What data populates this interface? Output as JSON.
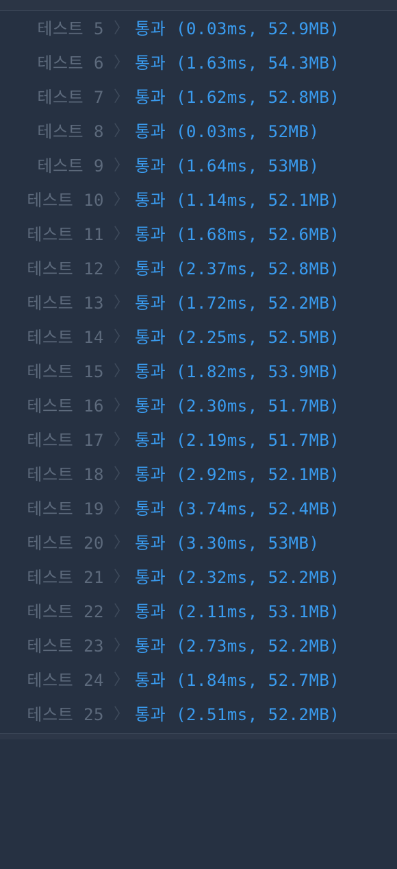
{
  "tests": [
    {
      "label": "테스트 5",
      "separator": "〉",
      "result": "통과 (0.03ms, 52.9MB)"
    },
    {
      "label": "테스트 6",
      "separator": "〉",
      "result": "통과 (1.63ms, 54.3MB)"
    },
    {
      "label": "테스트 7",
      "separator": "〉",
      "result": "통과 (1.62ms, 52.8MB)"
    },
    {
      "label": "테스트 8",
      "separator": "〉",
      "result": "통과 (0.03ms, 52MB)"
    },
    {
      "label": "테스트 9",
      "separator": "〉",
      "result": "통과 (1.64ms, 53MB)"
    },
    {
      "label": "테스트 10",
      "separator": "〉",
      "result": "통과 (1.14ms, 52.1MB)"
    },
    {
      "label": "테스트 11",
      "separator": "〉",
      "result": "통과 (1.68ms, 52.6MB)"
    },
    {
      "label": "테스트 12",
      "separator": "〉",
      "result": "통과 (2.37ms, 52.8MB)"
    },
    {
      "label": "테스트 13",
      "separator": "〉",
      "result": "통과 (1.72ms, 52.2MB)"
    },
    {
      "label": "테스트 14",
      "separator": "〉",
      "result": "통과 (2.25ms, 52.5MB)"
    },
    {
      "label": "테스트 15",
      "separator": "〉",
      "result": "통과 (1.82ms, 53.9MB)"
    },
    {
      "label": "테스트 16",
      "separator": "〉",
      "result": "통과 (2.30ms, 51.7MB)"
    },
    {
      "label": "테스트 17",
      "separator": "〉",
      "result": "통과 (2.19ms, 51.7MB)"
    },
    {
      "label": "테스트 18",
      "separator": "〉",
      "result": "통과 (2.92ms, 52.1MB)"
    },
    {
      "label": "테스트 19",
      "separator": "〉",
      "result": "통과 (3.74ms, 52.4MB)"
    },
    {
      "label": "테스트 20",
      "separator": "〉",
      "result": "통과 (3.30ms, 53MB)"
    },
    {
      "label": "테스트 21",
      "separator": "〉",
      "result": "통과 (2.32ms, 52.2MB)"
    },
    {
      "label": "테스트 22",
      "separator": "〉",
      "result": "통과 (2.11ms, 53.1MB)"
    },
    {
      "label": "테스트 23",
      "separator": "〉",
      "result": "통과 (2.73ms, 52.2MB)"
    },
    {
      "label": "테스트 24",
      "separator": "〉",
      "result": "통과 (1.84ms, 52.7MB)"
    },
    {
      "label": "테스트 25",
      "separator": "〉",
      "result": "통과 (2.51ms, 52.2MB)"
    }
  ],
  "colors": {
    "background": "#263142",
    "label": "#5d6a7c",
    "separator": "#3f4b5c",
    "pass": "#3a9cf0"
  }
}
